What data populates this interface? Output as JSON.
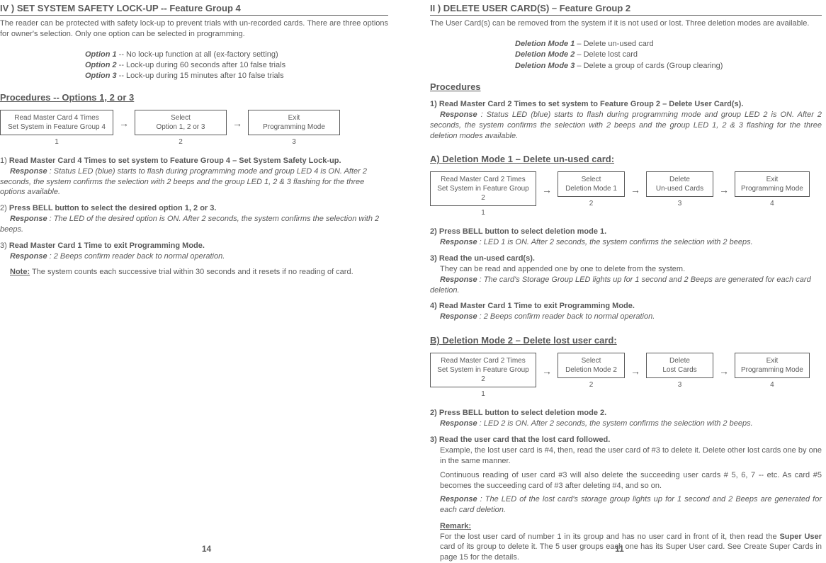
{
  "left": {
    "title": "IV ) SET SYSTEM SAFETY LOCK-UP -- Feature Group 4",
    "intro": "The reader can be protected with safety lock-up to prevent trials with un-recorded cards. There are three options for owner's selection. Only one option can be selected in programming.",
    "options": {
      "o1l": "Option 1",
      "o1t": " -- No lock-up function at all (ex-factory setting)",
      "o2l": "Option 2",
      "o2t": " -- Lock-up during 60 seconds after 10 false trials",
      "o3l": "Option 3",
      "o3t": " -- Lock-up during 15 minutes after 10 false trials"
    },
    "proc_title": "Procedures -- Options 1, 2 or 3",
    "flow": {
      "b1a": "Read Master Card 4 Times",
      "b1b": "Set System in Feature Group 4",
      "b2a": "Select",
      "b2b": "Option 1, 2 or 3",
      "b3a": "Exit",
      "b3b": "Programming Mode",
      "n1": "1",
      "n2": "2",
      "n3": "3"
    },
    "s1": {
      "num": "1) ",
      "head": "Read Master Card 4 Times to set system to Feature Group 4 – Set System Safety Lock-up.",
      "r": "Response ",
      "rt": ": Status LED (blue) starts to flash during programming mode and group LED 4 is ON. After 2 seconds, the system confirms the selection with 2 beeps and the group LED 1, 2 & 3 flashing for the three options available."
    },
    "s2": {
      "num": "2) ",
      "head": "Press BELL button to select the desired option 1, 2 or 3.",
      "r": "Response ",
      "rt": ": The LED of the desired option is ON. After 2 seconds, the system confirms the selection with 2 beeps."
    },
    "s3": {
      "num": "3) ",
      "head": "Read Master Card 1 Time to exit Programming Mode.",
      "r": "Response ",
      "rt": ": 2 Beeps confirm reader back to normal operation."
    },
    "note_l": "Note:",
    "note_t": " The system counts each successive trial within 30 seconds and it resets if no reading of card.",
    "page": "14"
  },
  "right": {
    "title": "II ) DELETE USER CARD(S) – Feature Group 2",
    "intro": "The User Card(s) can be removed from the system if it is not used or lost. Three deletion modes are available.",
    "modes": {
      "m1l": "Deletion Mode 1",
      "m1t": " – Delete un-used card",
      "m2l": "Deletion Mode 2",
      "m2t": " – Delete lost card",
      "m3l": "Deletion Mode 3",
      "m3t": " – Delete a group of cards (Group clearing)"
    },
    "proc_title": "Procedures",
    "p1": {
      "num": "1) ",
      "head": "Read Master Card 2 Times to set system to Feature Group 2 – Delete User Card(s).",
      "r": "Response ",
      "rt": ": Status LED (blue) starts to flash during programming mode and group LED 2 is ON. After 2 seconds, the system confirms the selection with 2 beeps and the group LED 1, 2 & 3 flashing for the three deletion modes available."
    },
    "a_title": "A) Deletion Mode 1 – Delete un-used card:",
    "flowA": {
      "b1a": "Read Master Card 2 Times",
      "b1b": "Set System in Feature Group 2",
      "b2a": "Select",
      "b2b": "Deletion Mode 1",
      "b3a": "Delete",
      "b3b": "Un-used Cards",
      "b4a": "Exit",
      "b4b": "Programming Mode",
      "n1": "1",
      "n2": "2",
      "n3": "3",
      "n4": "4"
    },
    "a2": {
      "num": "2) ",
      "head": "Press BELL button to select deletion mode 1.",
      "r": "Response ",
      "rt": ": LED 1 is ON. After 2 seconds, the system confirms the selection with 2 beeps."
    },
    "a3": {
      "num": "3) ",
      "head": "Read the un-used card(s).",
      "body": "They can be read and appended one by one to delete from the system.",
      "r": "Response ",
      "rt": ": The card's Storage Group LED lights up for 1 second and 2 Beeps are generated for each card deletion."
    },
    "a4": {
      "num": "4) ",
      "head": "Read Master Card 1 Time to exit Programming Mode.",
      "r": "Response ",
      "rt": ": 2 Beeps confirm reader back to normal operation."
    },
    "b_title": "B) Deletion Mode 2 – Delete lost user card:",
    "flowB": {
      "b1a": "Read Master Card 2 Times",
      "b1b": "Set System in Feature Group 2",
      "b2a": "Select",
      "b2b": "Deletion Mode 2",
      "b3a": "Delete",
      "b3b": "Lost Cards",
      "b4a": "Exit",
      "b4b": "Programming Mode",
      "n1": "1",
      "n2": "2",
      "n3": "3",
      "n4": "4"
    },
    "b2": {
      "num": "2) ",
      "head": "Press BELL button to select deletion mode 2.",
      "r": "Response ",
      "rt": ": LED 2 is ON. After 2 seconds, the system confirms the selection with 2 beeps."
    },
    "b3": {
      "num": "3) ",
      "head": "Read the user card that the lost card followed.",
      "body1": "Example, the lost user card is #4, then, read the user card of #3 to delete it. Delete other lost cards one by one in the same manner.",
      "body2": "Continuous reading of user card #3 will also delete the succeeding user cards # 5, 6, 7 -- etc. As card #5 becomes the succeeding card of #3 after deleting #4, and so on.",
      "r": "Response ",
      "rt": ": The LED of the lost card's storage group lights up for 1 second and 2 Beeps are generated for each card deletion."
    },
    "remark_l": "Remark:",
    "remark_t1": "For the lost user card of number 1 in its group and has no user card in front of it, then read the ",
    "remark_su": "Super User",
    "remark_t2": " card of its group to delete it. The 5 user groups each one has its Super User card. See Create Super Cards in page 15 for the details.",
    "page": "11"
  },
  "arrow": "→"
}
